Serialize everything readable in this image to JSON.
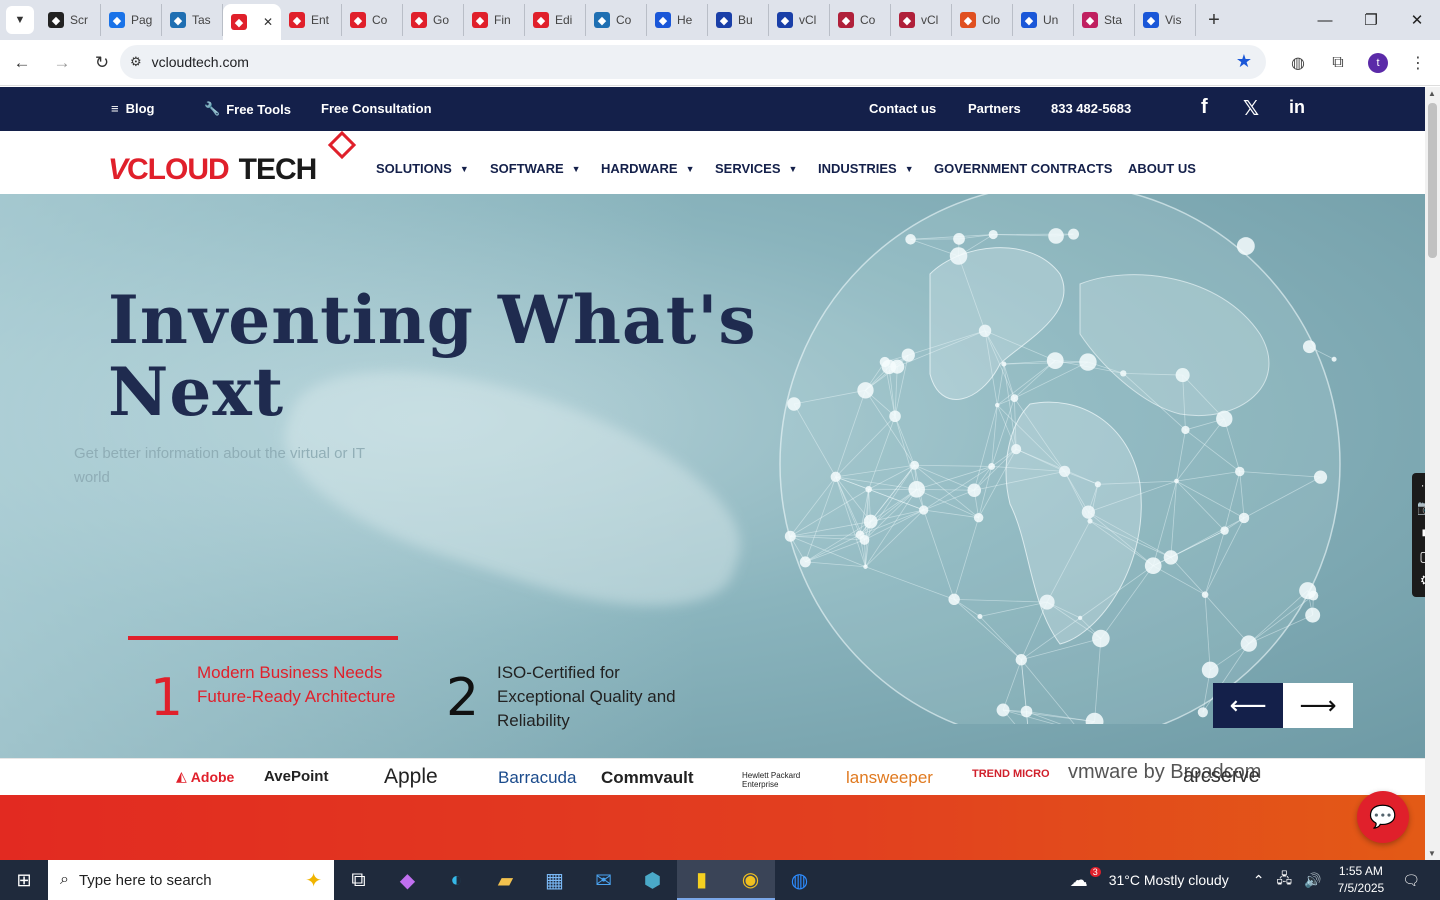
{
  "browser": {
    "tabs": [
      {
        "label": "Scr",
        "icon": "eye-icon",
        "color": "#222222"
      },
      {
        "label": "Pag",
        "icon": "speed-icon",
        "color": "#1a73e8"
      },
      {
        "label": "Tas",
        "icon": "hex-icon",
        "color": "#1f6fb2"
      },
      {
        "label": "",
        "icon": "vcloud-icon",
        "color": "#e0202b",
        "active": true
      },
      {
        "label": "Ent",
        "icon": "vcloud-icon",
        "color": "#e0202b"
      },
      {
        "label": "Co",
        "icon": "vcloud-icon",
        "color": "#e0202b"
      },
      {
        "label": "Go",
        "icon": "vcloud-icon",
        "color": "#e0202b"
      },
      {
        "label": "Fin",
        "icon": "vcloud-icon",
        "color": "#e0202b"
      },
      {
        "label": "Edi",
        "icon": "vcloud-icon",
        "color": "#e0202b"
      },
      {
        "label": "Co",
        "icon": "hex-icon",
        "color": "#1f6fb2"
      },
      {
        "label": "He",
        "icon": "scale-icon",
        "color": "#1a57d8"
      },
      {
        "label": "Bu",
        "icon": "x-icon",
        "color": "#1a3fa8"
      },
      {
        "label": "vCl",
        "icon": "check-icon",
        "color": "#1a3fa8"
      },
      {
        "label": "Co",
        "icon": "bug-icon",
        "color": "#b0203a"
      },
      {
        "label": "vCl",
        "icon": "v-icon",
        "color": "#b0203a"
      },
      {
        "label": "Clo",
        "icon": "feather-icon",
        "color": "#e05020"
      },
      {
        "label": "Un",
        "icon": "doc-icon",
        "color": "#1a57d8"
      },
      {
        "label": "Sta",
        "icon": "pen-icon",
        "color": "#c02060"
      },
      {
        "label": "Vis",
        "icon": "pulse-icon",
        "color": "#1a57d8"
      }
    ],
    "url": "vcloudtech.com",
    "profile_initial": "t"
  },
  "site": {
    "topbar": {
      "blog": "Blog",
      "free_tools": "Free Tools",
      "free_consultation": "Free Consultation",
      "contact": "Contact us",
      "partners": "Partners",
      "phone": "833 482-5683"
    },
    "logo": {
      "v": "V",
      "cloud": "CLOUD",
      "tech": "TECH"
    },
    "menu": {
      "solutions": "SOLUTIONS",
      "software": "SOFTWARE",
      "hardware": "HARDWARE",
      "services": "SERVICES",
      "industries": "INDUSTRIES",
      "government": "GOVERNMENT CONTRACTS",
      "about": "ABOUT US"
    },
    "hero": {
      "title": "Inventing What's Next",
      "subtitle": "Get better information about the virtual or IT world",
      "slides": [
        {
          "num": "1",
          "text": "Modern Business Needs Future-Ready Architecture"
        },
        {
          "num": "2",
          "text": "ISO-Certified for Exceptional Quality and Reliability"
        }
      ]
    },
    "brands": [
      "Adobe",
      "AvePoint",
      "Apple",
      "Barracuda",
      "Commvault",
      "Hewlett Packard Enterprise",
      "lansweeper",
      "TREND MICRO",
      "vmware by Broadcom",
      "arcserve"
    ]
  },
  "taskbar": {
    "search_placeholder": "Type here to search",
    "weather": "31°C  Mostly cloudy",
    "weather_badge": "3",
    "time": "1:55 AM",
    "date": "7/5/2025"
  },
  "colors": {
    "navy": "#14204a",
    "red": "#e0202b",
    "orange": "#e35a16"
  }
}
